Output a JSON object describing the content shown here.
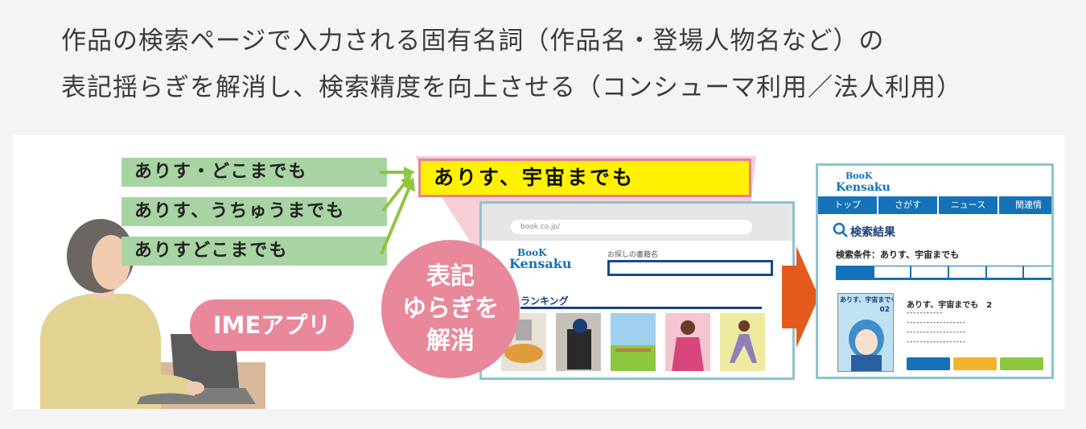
{
  "heading": {
    "line1": "作品の検索ページで入力される固有名詞（作品名・登場人物名など）の",
    "line2": "表記揺らぎを解消し、検索精度を向上させる（コンシューマ利用／法人利用）"
  },
  "variants": [
    "ありす・どこまでも",
    "ありす、うちゅうまでも",
    "ありすどこまでも"
  ],
  "correct_term": "ありす、宇宙までも",
  "ime_label": "IMEアプリ",
  "resolve_label": [
    "表記",
    "ゆらぎを",
    "解消"
  ],
  "browser": {
    "url": "book.co.jp/",
    "logo_top": "BooK",
    "logo_bottom": "Kensaku",
    "search_label": "お探しの書籍名",
    "ranking_label": "ランキング"
  },
  "results": {
    "logo_top": "BooK",
    "logo_bottom": "Kensaku",
    "nav": [
      "トップ",
      "さがす",
      "ニュース",
      "関連情"
    ],
    "title": "検索結果",
    "condition": "検索条件：ありす、宇宙までも",
    "book_title": "ありす、宇宙までも　2",
    "cover_text": "ありす、宇宙までも",
    "cover_number": "02",
    "buttons": [
      "#1572b8",
      "#f3b32b",
      "#8dc63f"
    ]
  },
  "colors": {
    "accent_pink": "#e8889a",
    "variant_green": "#a8d3a3",
    "highlight_yellow": "#fff200",
    "arrow_green": "#8dc63f",
    "arrow_orange": "#e35a1c",
    "brand_blue": "#1572b8"
  }
}
